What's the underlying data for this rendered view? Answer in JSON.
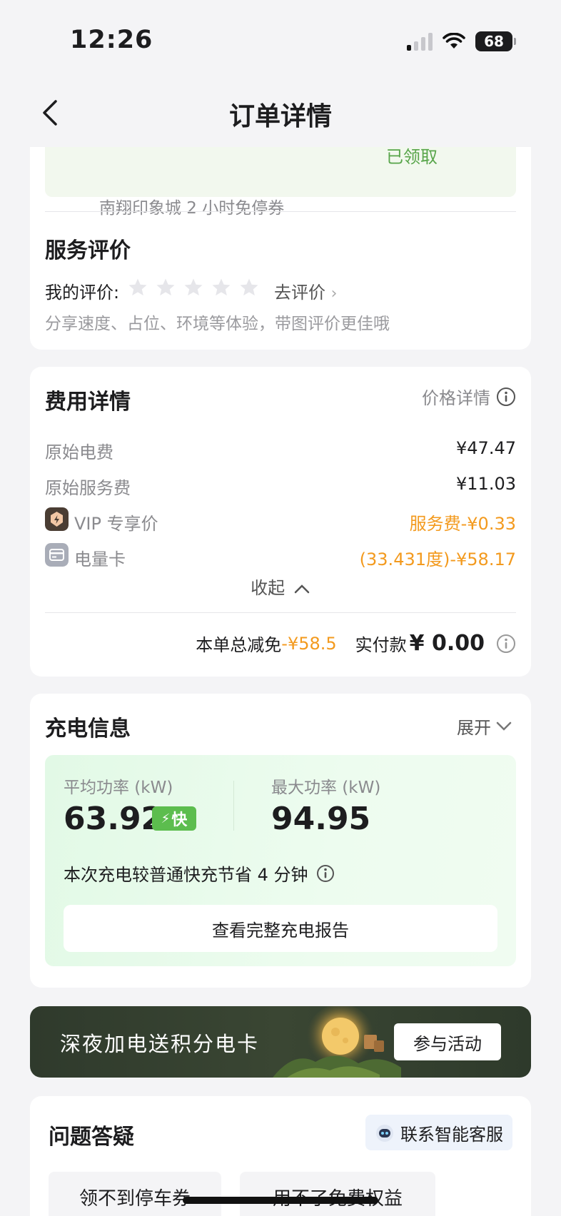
{
  "status_bar": {
    "time": "12:26",
    "battery": "68"
  },
  "nav": {
    "title": "订单详情"
  },
  "coupon": {
    "text": "南翔印象城 2 小时免停券",
    "status": "已领取"
  },
  "rating": {
    "title": "服务评价",
    "label": "我的评价:",
    "stars_filled": 0,
    "stars_total": 5,
    "go_rate": "去评价",
    "hint": "分享速度、占位、环境等体验，带图评价更佳哦"
  },
  "fees": {
    "title": "费用详情",
    "price_detail": "价格详情",
    "rows": [
      {
        "label": "原始电费",
        "value": "¥47.47"
      },
      {
        "label": "原始服务费",
        "value": "¥11.03"
      },
      {
        "label": "VIP 专享价",
        "value": "服务费-¥0.33"
      },
      {
        "label": "电量卡",
        "value": "(33.431度)-¥58.17"
      }
    ],
    "collapse": "收起",
    "total_discount_label": "本单总减免",
    "total_discount": "-¥58.5",
    "paid_label": "实付款",
    "paid_amount": "¥ 0.00"
  },
  "charging": {
    "title": "充电信息",
    "expand": "展开",
    "avg_label": "平均功率 (kW)",
    "avg_value": "63.92",
    "fast_tag": "快",
    "max_label": "最大功率 (kW)",
    "max_value": "94.95",
    "save_text": "本次充电较普通快充节省 4 分钟",
    "report_button": "查看完整充电报告"
  },
  "promo": {
    "text": "深夜加电送积分电卡",
    "button": "参与活动"
  },
  "faq": {
    "title": "问题答疑",
    "service_button": "联系智能客服",
    "chips": [
      "领不到停车券",
      "用不了免费权益"
    ]
  },
  "colors": {
    "accent_orange": "#f39a1e",
    "green": "#5cbd4e",
    "banner_dark": "#2f3a2c"
  }
}
